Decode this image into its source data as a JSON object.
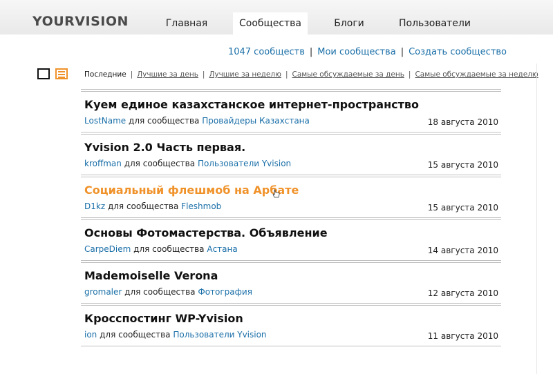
{
  "header": {
    "logo": "YOURVISION",
    "tabs": [
      {
        "label": "Главная"
      },
      {
        "label": "Сообщества"
      },
      {
        "label": "Блоги"
      },
      {
        "label": "Пользователи"
      }
    ],
    "active_tab": "Сообщества"
  },
  "sublinks": {
    "count_link": "1047 сообществ",
    "my_link": "Мои сообщества",
    "create_link": "Создать сообщество",
    "separator": "|"
  },
  "filters": {
    "items": [
      {
        "label": "Последние"
      },
      {
        "label": "Лучшие за день"
      },
      {
        "label": "Лучшие за неделю"
      },
      {
        "label": "Самые обсуждаемые за день"
      },
      {
        "label": "Самые обсуждаемые за неделю"
      }
    ],
    "separator": "|"
  },
  "posts": [
    {
      "title": "Куем единое казахстанское интернет-пространство",
      "author": "LostName",
      "for_text": "для сообщества",
      "community": "Провайдеры Казахстана",
      "date": "18 августа 2010"
    },
    {
      "title": "Yvision 2.0 Часть первая.",
      "author": "kroffman",
      "for_text": "для сообщества",
      "community": "Пользователи Yvision",
      "date": "15 августа 2010"
    },
    {
      "title": "Социальный флешмоб на Арбате",
      "author": "D1kz",
      "for_text": "для сообщества",
      "community": "Fleshmob",
      "date": "15 августа 2010"
    },
    {
      "title": "Основы Фотомастерства. Объявление",
      "author": "CarpeDiem",
      "for_text": "для сообщества",
      "community": "Астана",
      "date": "14 августа 2010"
    },
    {
      "title": "Mademoiselle Verona",
      "author": "gromaler",
      "for_text": "для сообщества",
      "community": "Фотография",
      "date": "12 августа 2010"
    },
    {
      "title": "Кросспостинг WP-Yvision",
      "author": "ion",
      "for_text": "для сообщества",
      "community": "Пользователи Yvision",
      "date": "11 августа 2010"
    }
  ],
  "colors": {
    "link": "#1a6fa8",
    "accent": "#f0922a",
    "text": "#111111"
  },
  "icons": {
    "view_single": "single-view-icon",
    "view_list": "list-view-icon",
    "cursor": "hand-pointer-icon"
  }
}
